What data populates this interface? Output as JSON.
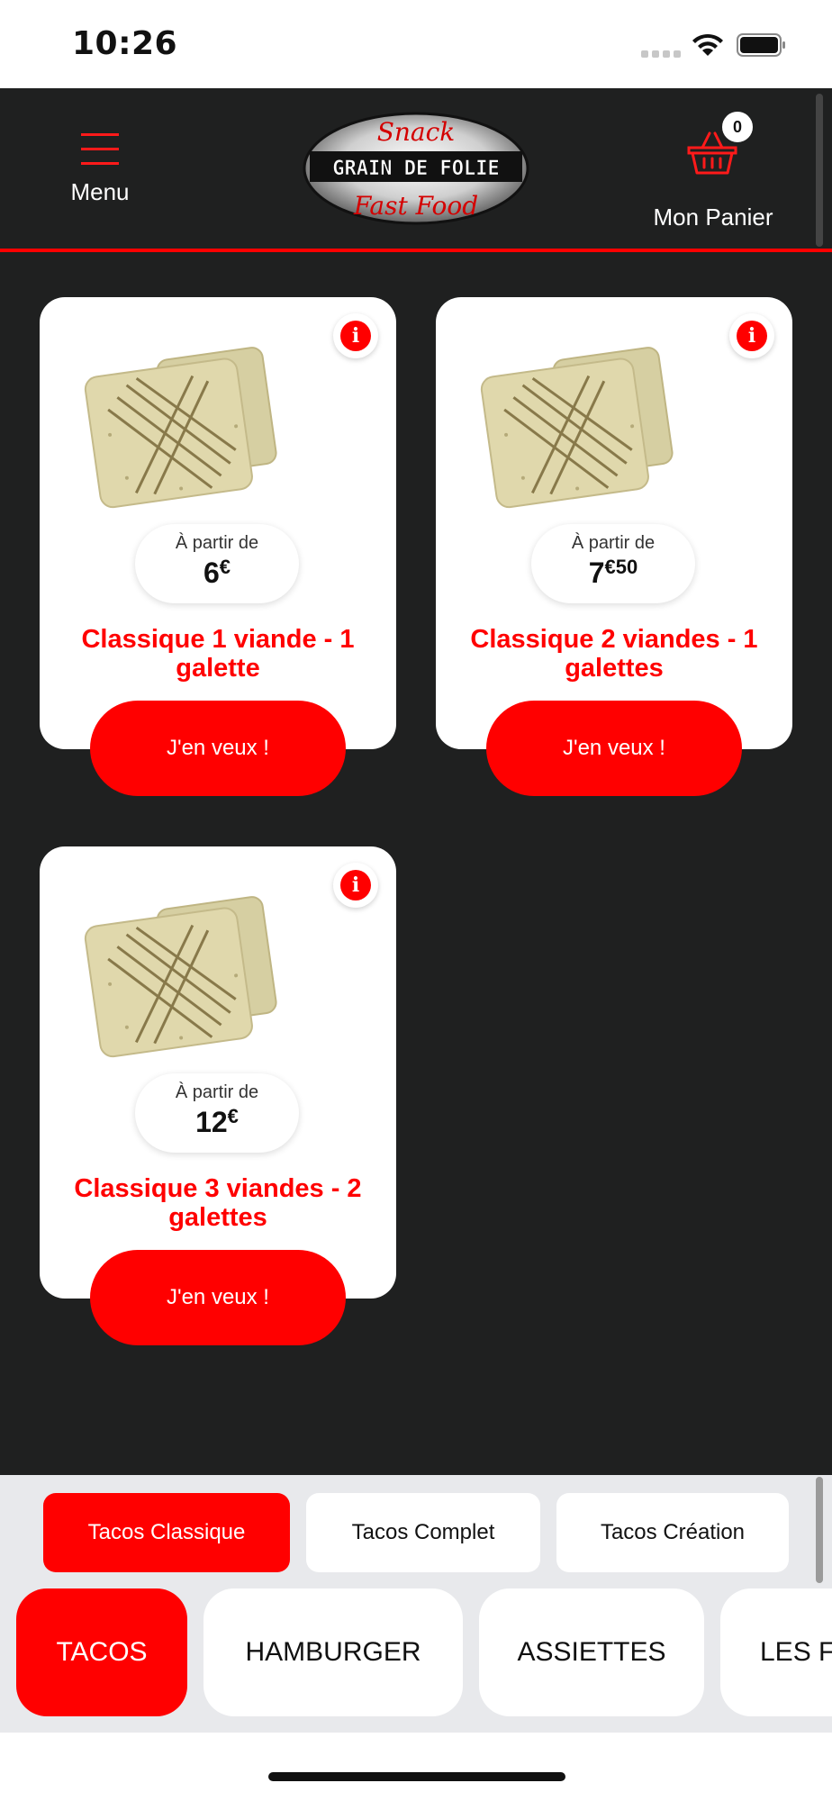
{
  "status_bar": {
    "time": "10:26",
    "icons": [
      "signal-icon",
      "wifi-icon",
      "battery-icon"
    ]
  },
  "header": {
    "menu_label": "Menu",
    "logo_text": {
      "top": "Snack",
      "middle": "GRAIN DE FOLIE",
      "bottom": "Fast Food"
    },
    "cart_label": "Mon Panier",
    "cart_count": "0"
  },
  "products": [
    {
      "price_prefix": "À partir de",
      "price_main": "6",
      "price_currency": "€",
      "price_cents": "",
      "name": "Classique 1 viande - 1 galette",
      "cta": "J'en veux !"
    },
    {
      "price_prefix": "À partir de",
      "price_main": "7",
      "price_currency": "€",
      "price_cents": "50",
      "name": "Classique 2 viandes - 1 galettes",
      "cta": "J'en veux !"
    },
    {
      "price_prefix": "À partir de",
      "price_main": "12",
      "price_currency": "€",
      "price_cents": "",
      "name": "Classique 3 viandes - 2 galettes",
      "cta": "J'en veux !"
    }
  ],
  "subcategories": [
    {
      "label": "Tacos Classique",
      "active": true
    },
    {
      "label": "Tacos Complet",
      "active": false
    },
    {
      "label": "Tacos Création",
      "active": false
    }
  ],
  "categories": [
    {
      "label": "TACOS",
      "active": true
    },
    {
      "label": "HAMBURGER",
      "active": false
    },
    {
      "label": "ASSIETTES",
      "active": false
    },
    {
      "label": "LES F",
      "active": false
    }
  ],
  "colors": {
    "accent": "#ff0000",
    "header_bg": "#1f2020",
    "tab_bar_bg": "#e8e9ec",
    "card_bg": "#ffffff"
  }
}
